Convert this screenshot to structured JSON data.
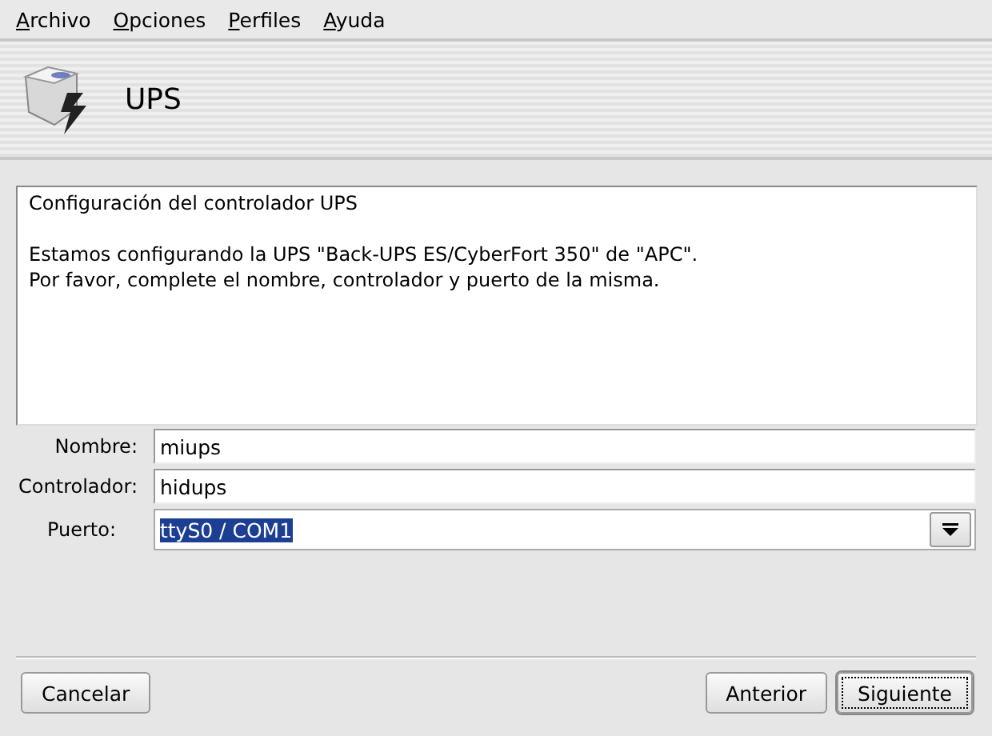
{
  "menu_bar": [
    {
      "label": "Archivo"
    },
    {
      "label": "Opciones"
    },
    {
      "label": "Perfiles"
    },
    {
      "label": "Ayuda"
    }
  ],
  "header": {
    "title": "UPS"
  },
  "description": {
    "title": "Configuración del controlador UPS",
    "lines": [
      "Estamos configurando la UPS \"Back-UPS ES/CyberFort 350\" de \"APC\".",
      "Por favor, complete el nombre, controlador y puerto de la misma."
    ]
  },
  "fields": [
    {
      "kind": "text",
      "label": "Nombre:",
      "value": "miups"
    },
    {
      "kind": "text",
      "label": "Controlador:",
      "value": "hidups"
    },
    {
      "kind": "combo",
      "label": "Puerto:",
      "value": "ttyS0 / COM1",
      "text_selected": true
    }
  ],
  "buttons_left": [
    {
      "label": "Cancelar",
      "default": false
    }
  ],
  "buttons_right": [
    {
      "label": "Anterior",
      "default": false
    },
    {
      "label": "Siguiente",
      "default": true
    }
  ]
}
